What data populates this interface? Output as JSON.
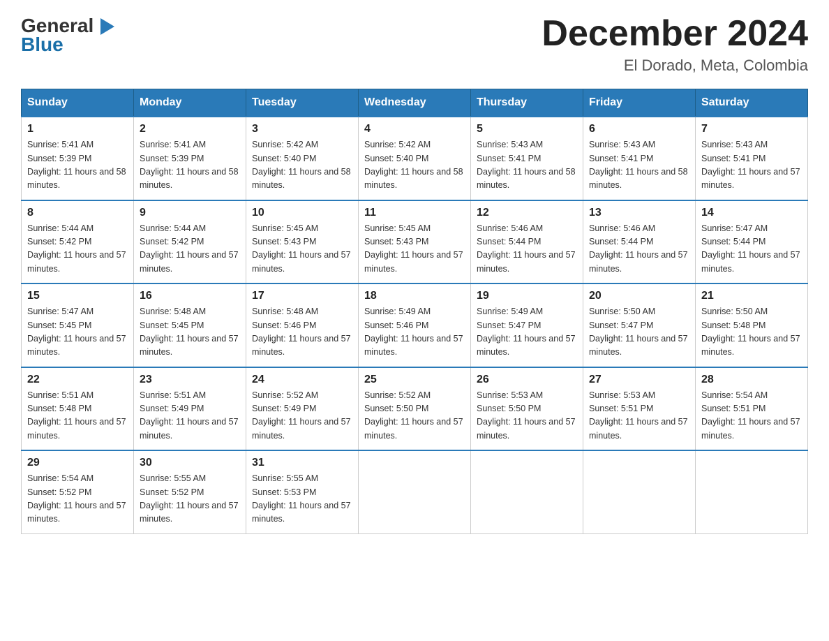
{
  "header": {
    "logo": {
      "general": "General",
      "blue": "Blue",
      "arrow": "▶"
    },
    "title": "December 2024",
    "subtitle": "El Dorado, Meta, Colombia"
  },
  "weekdays": [
    "Sunday",
    "Monday",
    "Tuesday",
    "Wednesday",
    "Thursday",
    "Friday",
    "Saturday"
  ],
  "weeks": [
    [
      {
        "day": "1",
        "sunrise": "5:41 AM",
        "sunset": "5:39 PM",
        "daylight": "11 hours and 58 minutes."
      },
      {
        "day": "2",
        "sunrise": "5:41 AM",
        "sunset": "5:39 PM",
        "daylight": "11 hours and 58 minutes."
      },
      {
        "day": "3",
        "sunrise": "5:42 AM",
        "sunset": "5:40 PM",
        "daylight": "11 hours and 58 minutes."
      },
      {
        "day": "4",
        "sunrise": "5:42 AM",
        "sunset": "5:40 PM",
        "daylight": "11 hours and 58 minutes."
      },
      {
        "day": "5",
        "sunrise": "5:43 AM",
        "sunset": "5:41 PM",
        "daylight": "11 hours and 58 minutes."
      },
      {
        "day": "6",
        "sunrise": "5:43 AM",
        "sunset": "5:41 PM",
        "daylight": "11 hours and 58 minutes."
      },
      {
        "day": "7",
        "sunrise": "5:43 AM",
        "sunset": "5:41 PM",
        "daylight": "11 hours and 57 minutes."
      }
    ],
    [
      {
        "day": "8",
        "sunrise": "5:44 AM",
        "sunset": "5:42 PM",
        "daylight": "11 hours and 57 minutes."
      },
      {
        "day": "9",
        "sunrise": "5:44 AM",
        "sunset": "5:42 PM",
        "daylight": "11 hours and 57 minutes."
      },
      {
        "day": "10",
        "sunrise": "5:45 AM",
        "sunset": "5:43 PM",
        "daylight": "11 hours and 57 minutes."
      },
      {
        "day": "11",
        "sunrise": "5:45 AM",
        "sunset": "5:43 PM",
        "daylight": "11 hours and 57 minutes."
      },
      {
        "day": "12",
        "sunrise": "5:46 AM",
        "sunset": "5:44 PM",
        "daylight": "11 hours and 57 minutes."
      },
      {
        "day": "13",
        "sunrise": "5:46 AM",
        "sunset": "5:44 PM",
        "daylight": "11 hours and 57 minutes."
      },
      {
        "day": "14",
        "sunrise": "5:47 AM",
        "sunset": "5:44 PM",
        "daylight": "11 hours and 57 minutes."
      }
    ],
    [
      {
        "day": "15",
        "sunrise": "5:47 AM",
        "sunset": "5:45 PM",
        "daylight": "11 hours and 57 minutes."
      },
      {
        "day": "16",
        "sunrise": "5:48 AM",
        "sunset": "5:45 PM",
        "daylight": "11 hours and 57 minutes."
      },
      {
        "day": "17",
        "sunrise": "5:48 AM",
        "sunset": "5:46 PM",
        "daylight": "11 hours and 57 minutes."
      },
      {
        "day": "18",
        "sunrise": "5:49 AM",
        "sunset": "5:46 PM",
        "daylight": "11 hours and 57 minutes."
      },
      {
        "day": "19",
        "sunrise": "5:49 AM",
        "sunset": "5:47 PM",
        "daylight": "11 hours and 57 minutes."
      },
      {
        "day": "20",
        "sunrise": "5:50 AM",
        "sunset": "5:47 PM",
        "daylight": "11 hours and 57 minutes."
      },
      {
        "day": "21",
        "sunrise": "5:50 AM",
        "sunset": "5:48 PM",
        "daylight": "11 hours and 57 minutes."
      }
    ],
    [
      {
        "day": "22",
        "sunrise": "5:51 AM",
        "sunset": "5:48 PM",
        "daylight": "11 hours and 57 minutes."
      },
      {
        "day": "23",
        "sunrise": "5:51 AM",
        "sunset": "5:49 PM",
        "daylight": "11 hours and 57 minutes."
      },
      {
        "day": "24",
        "sunrise": "5:52 AM",
        "sunset": "5:49 PM",
        "daylight": "11 hours and 57 minutes."
      },
      {
        "day": "25",
        "sunrise": "5:52 AM",
        "sunset": "5:50 PM",
        "daylight": "11 hours and 57 minutes."
      },
      {
        "day": "26",
        "sunrise": "5:53 AM",
        "sunset": "5:50 PM",
        "daylight": "11 hours and 57 minutes."
      },
      {
        "day": "27",
        "sunrise": "5:53 AM",
        "sunset": "5:51 PM",
        "daylight": "11 hours and 57 minutes."
      },
      {
        "day": "28",
        "sunrise": "5:54 AM",
        "sunset": "5:51 PM",
        "daylight": "11 hours and 57 minutes."
      }
    ],
    [
      {
        "day": "29",
        "sunrise": "5:54 AM",
        "sunset": "5:52 PM",
        "daylight": "11 hours and 57 minutes."
      },
      {
        "day": "30",
        "sunrise": "5:55 AM",
        "sunset": "5:52 PM",
        "daylight": "11 hours and 57 minutes."
      },
      {
        "day": "31",
        "sunrise": "5:55 AM",
        "sunset": "5:53 PM",
        "daylight": "11 hours and 57 minutes."
      },
      null,
      null,
      null,
      null
    ]
  ]
}
